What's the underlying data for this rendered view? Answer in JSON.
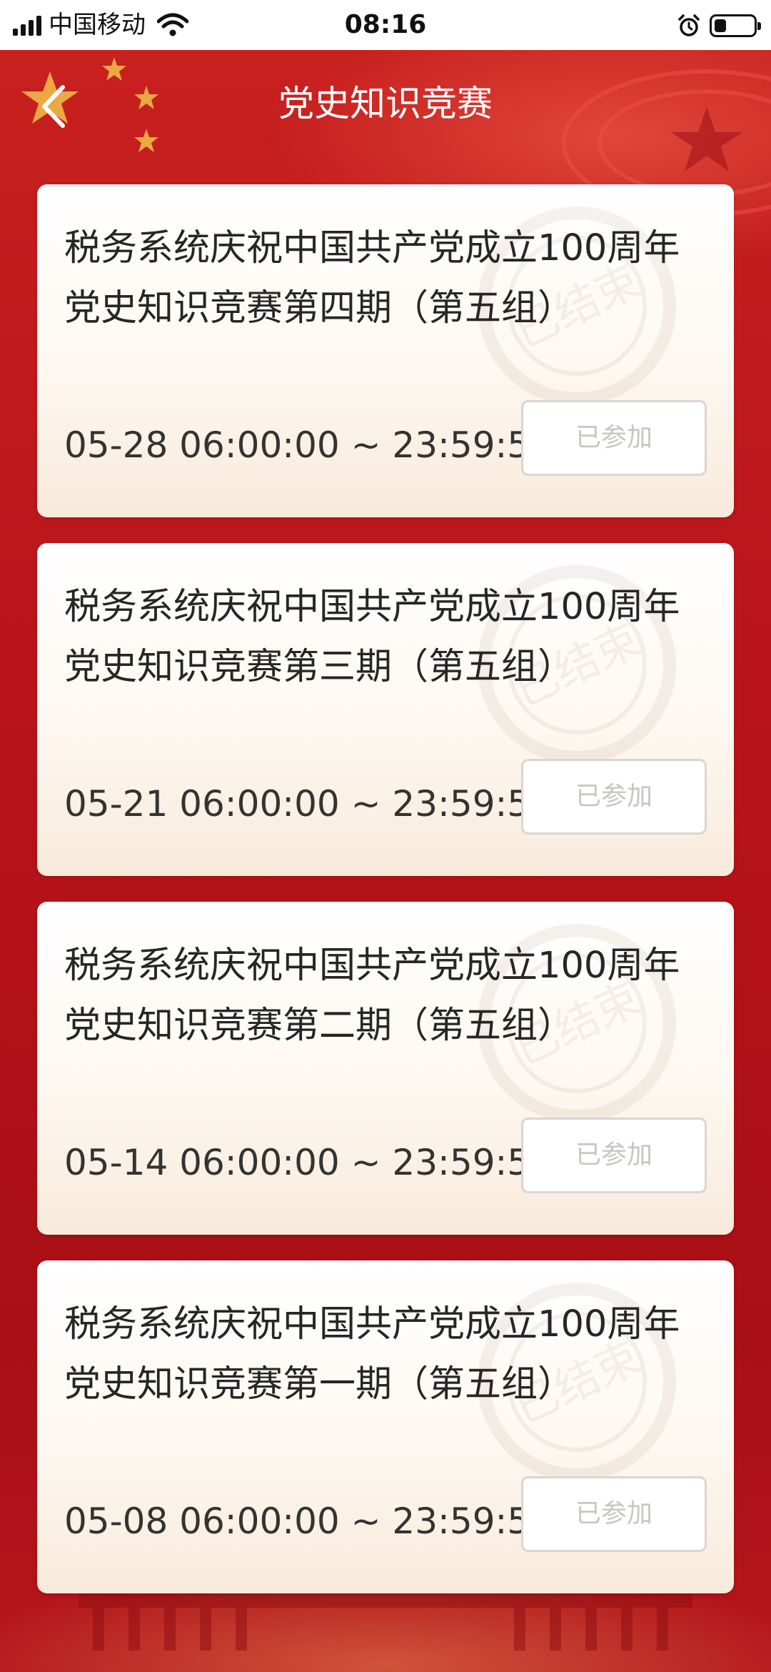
{
  "status_bar": {
    "carrier": "中国移动",
    "time": "08:16",
    "battery_level": 0.3
  },
  "header": {
    "title": "党史知识竞赛"
  },
  "quizzes": [
    {
      "title": "税务系统庆祝中国共产党成立100周年党史知识竞赛第四期（第五组）",
      "time": "05-28 06:00:00 ~ 23:59:59",
      "status": "已参加"
    },
    {
      "title": "税务系统庆祝中国共产党成立100周年党史知识竞赛第三期（第五组）",
      "time": "05-21 06:00:00 ~ 23:59:59",
      "status": "已参加"
    },
    {
      "title": "税务系统庆祝中国共产党成立100周年党史知识竞赛第二期（第五组）",
      "time": "05-14 06:00:00 ~ 23:59:59",
      "status": "已参加"
    },
    {
      "title": "税务系统庆祝中国共产党成立100周年党史知识竞赛第一期（第五组）",
      "time": "05-08 06:00:00 ~ 23:59:59",
      "status": "已参加"
    }
  ],
  "stamp_text": "已结束",
  "colors": {
    "primary_red": "#b8141a",
    "card_bg": "#fdf8f1",
    "disabled_text": "#c8c6c3"
  }
}
